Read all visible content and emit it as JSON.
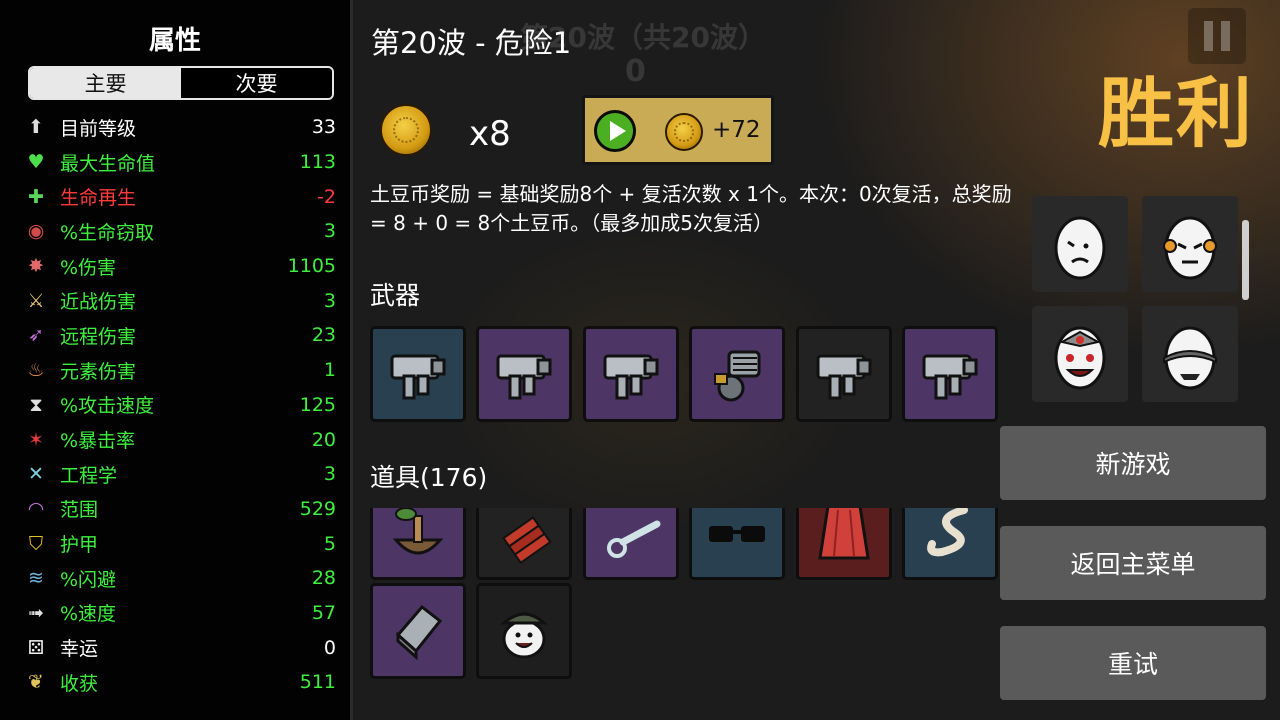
{
  "stats": {
    "title": "属性",
    "tab_primary": "主要",
    "tab_secondary": "次要",
    "items": [
      {
        "label": "目前等级",
        "value": "33",
        "color": "#ffffff",
        "icon": "level-up-icon"
      },
      {
        "label": "最大生命值",
        "value": "113",
        "color": "#3ef03e",
        "icon": "heart-icon"
      },
      {
        "label": "生命再生",
        "value": "-2",
        "color": "#ff3b3b",
        "icon": "regen-icon"
      },
      {
        "label": "%生命窃取",
        "value": "3",
        "color": "#3ef03e",
        "icon": "life-steal-icon"
      },
      {
        "label": "%伤害",
        "value": "1105",
        "color": "#3ef03e",
        "icon": "damage-icon"
      },
      {
        "label": "近战伤害",
        "value": "3",
        "color": "#3ef03e",
        "icon": "melee-sword-icon"
      },
      {
        "label": "远程伤害",
        "value": "23",
        "color": "#3ef03e",
        "icon": "ranged-bow-icon"
      },
      {
        "label": "元素伤害",
        "value": "1",
        "color": "#3ef03e",
        "icon": "fire-icon"
      },
      {
        "label": "%攻击速度",
        "value": "125",
        "color": "#3ef03e",
        "icon": "hourglass-icon"
      },
      {
        "label": "%暴击率",
        "value": "20",
        "color": "#3ef03e",
        "icon": "crit-icon"
      },
      {
        "label": "工程学",
        "value": "3",
        "color": "#3ef03e",
        "icon": "wrench-icon"
      },
      {
        "label": "范围",
        "value": "529",
        "color": "#3ef03e",
        "icon": "range-icon"
      },
      {
        "label": "护甲",
        "value": "5",
        "color": "#3ef03e",
        "icon": "shield-icon"
      },
      {
        "label": "%闪避",
        "value": "28",
        "color": "#3ef03e",
        "icon": "dodge-icon"
      },
      {
        "label": "%速度",
        "value": "57",
        "color": "#3ef03e",
        "icon": "speed-boot-icon"
      },
      {
        "label": "幸运",
        "value": "0",
        "color": "#ffffff",
        "icon": "dice-icon"
      },
      {
        "label": "收获",
        "value": "511",
        "color": "#3ef03e",
        "icon": "harvest-icon"
      }
    ]
  },
  "main": {
    "wave_title": "第20波 - 危险1",
    "ghost_wave": "第20波（共20波）",
    "ghost_count": "0",
    "reward_multiplier": "x8",
    "ad_reward": "+72",
    "description": "土豆币奖励 = 基础奖励8个 + 复活次数 x 1个。本次：0次复活，总奖励 = 8 + 0 = 8个土豆币。（最多加成5次复活）",
    "weapons_label": "武器",
    "items_label": "道具(176)"
  },
  "right": {
    "victory": "胜利",
    "new_game": "新游戏",
    "main_menu": "返回主菜单",
    "retry": "重试"
  },
  "colors": {
    "victory": "#f8c146",
    "ad_button": "#c9aa55",
    "stat_green": "#3ef03e",
    "stat_red": "#ff3b3b"
  }
}
